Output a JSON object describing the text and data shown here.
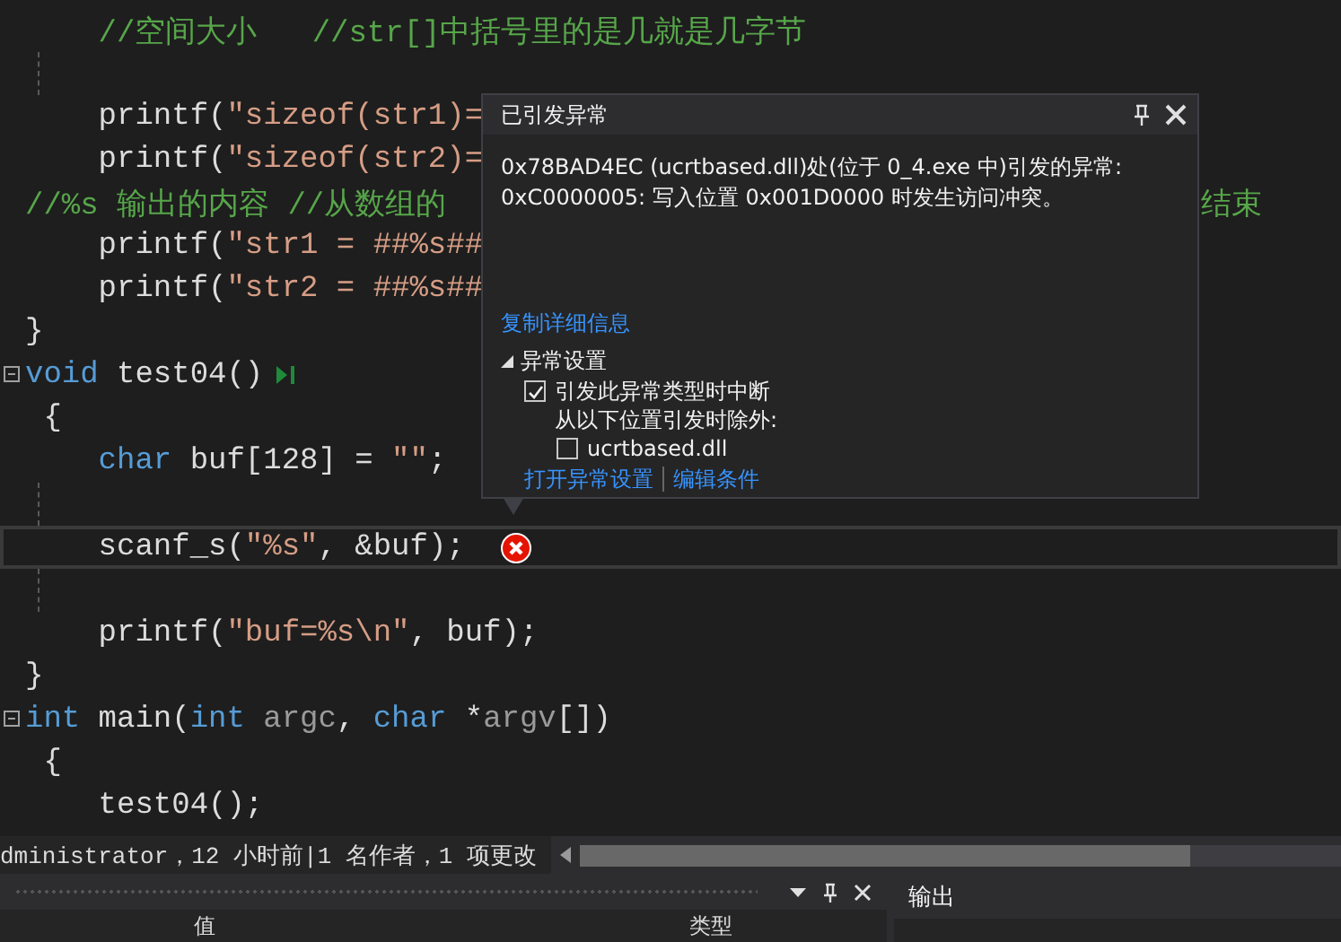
{
  "editor": {
    "lines": [
      {
        "segments": [
          {
            "kind": "comment",
            "text": "    //空间大小   //str[]中括号里的是几就是几字节"
          }
        ]
      },
      {
        "kind": "blank"
      },
      {
        "segments": [
          {
            "kind": "plain",
            "text": "    printf("
          },
          {
            "kind": "string",
            "text": "\"sizeof(str1)="
          }
        ]
      },
      {
        "segments": [
          {
            "kind": "plain",
            "text": "    printf("
          },
          {
            "kind": "string",
            "text": "\"sizeof(str2)="
          }
        ]
      },
      {
        "segments": [
          {
            "kind": "comment",
            "text": "//%s 输出的内容 //从数组的"
          }
        ],
        "right_text": "结束"
      },
      {
        "segments": [
          {
            "kind": "plain",
            "text": "    printf("
          },
          {
            "kind": "string",
            "text": "\"str1 = ##%s##"
          }
        ]
      },
      {
        "segments": [
          {
            "kind": "plain",
            "text": "    printf("
          },
          {
            "kind": "string",
            "text": "\"str2 = ##%s##"
          }
        ]
      },
      {
        "segments": [
          {
            "kind": "plain",
            "text": "}"
          }
        ]
      },
      {
        "segments": [
          {
            "kind": "keyword",
            "text": "void"
          },
          {
            "kind": "plain",
            "text": " test04()"
          }
        ],
        "collapse": true,
        "run_marker": true
      },
      {
        "segments": [
          {
            "kind": "plain",
            "text": " {"
          }
        ]
      },
      {
        "segments": [
          {
            "kind": "keyword",
            "text": "    char"
          },
          {
            "kind": "plain",
            "text": " buf[128] = "
          },
          {
            "kind": "string",
            "text": "\"\""
          },
          {
            "kind": "plain",
            "text": ";"
          }
        ]
      },
      {
        "kind": "blank"
      },
      {
        "segments": [
          {
            "kind": "plain",
            "text": "    scanf_s("
          },
          {
            "kind": "string",
            "text": "\"%s\""
          },
          {
            "kind": "plain",
            "text": ", &buf);"
          }
        ],
        "current": true,
        "error": true
      },
      {
        "kind": "blank"
      },
      {
        "segments": [
          {
            "kind": "plain",
            "text": "    printf("
          },
          {
            "kind": "string",
            "text": "\"buf=%s\\n\""
          },
          {
            "kind": "plain",
            "text": ", buf);"
          }
        ]
      },
      {
        "segments": [
          {
            "kind": "plain",
            "text": "}"
          }
        ]
      },
      {
        "segments": [
          {
            "kind": "keyword",
            "text": "int"
          },
          {
            "kind": "plain",
            "text": " main("
          },
          {
            "kind": "keyword",
            "text": "int"
          },
          {
            "kind": "param",
            "text": " argc"
          },
          {
            "kind": "plain",
            "text": ", "
          },
          {
            "kind": "keyword",
            "text": "char"
          },
          {
            "kind": "plain",
            "text": " *"
          },
          {
            "kind": "param",
            "text": "argv"
          },
          {
            "kind": "plain",
            "text": "[])"
          }
        ],
        "collapse": true
      },
      {
        "segments": [
          {
            "kind": "plain",
            "text": " {"
          }
        ]
      },
      {
        "segments": [
          {
            "kind": "plain",
            "text": "    test04();"
          }
        ]
      }
    ]
  },
  "exception_popup": {
    "title": "已引发异常",
    "message": [
      "0x78BAD4EC (ucrtbased.dll)处(位于 0_4.exe 中)引发的异常:",
      "0xC0000005: 写入位置 0x001D0000 时发生访问冲突。"
    ],
    "copy_link": "复制详细信息",
    "section": {
      "label": "异常设置",
      "expanded": true
    },
    "break_option": {
      "label": "引发此异常类型时中断",
      "checked": true
    },
    "except_label": "从以下位置引发时除外:",
    "module_option": {
      "label": "ucrtbased.dll",
      "checked": false
    },
    "links": [
      "打开异常设置",
      "编辑条件"
    ]
  },
  "status_bar": {
    "text": "dministrator，12 小时前|1 名作者，1 项更改"
  },
  "locals_panel": {
    "columns": [
      "值",
      "类型"
    ]
  },
  "output_panel": {
    "title": "输出"
  }
}
